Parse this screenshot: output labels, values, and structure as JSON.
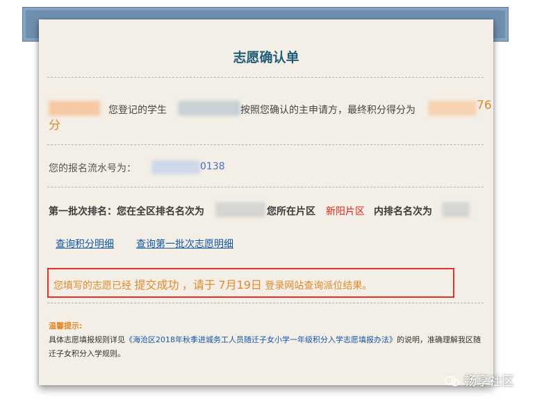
{
  "form": {
    "title": "志愿确认单",
    "line1": {
      "prefix": "您登记的学生",
      "middle": "按照您确认的主申请方，最终积分得分为",
      "score_tail": "76",
      "score_unit": "分"
    },
    "line2": {
      "label": "您的报名流水号为：",
      "serial_tail": "0138"
    },
    "line3": {
      "part1": "第一批次排名：您在全区排名名次为",
      "part2": "您所在片区",
      "district": "新阳片区",
      "part3": "内排名名次为"
    },
    "links": {
      "points_detail": "查询积分明细",
      "first_batch_detail": "查询第一批次志愿明细"
    },
    "notice": {
      "p1": "您填写的志愿已经",
      "p2": "提交成功",
      "p3": "，请于",
      "p4": "7月19日",
      "p5": "登录网站查询派位结果。"
    },
    "tips": {
      "title": "温馨提示:",
      "before": "具体志愿填报规则详见",
      "rule_link": "《海沧区2018年秋季进城务工人员随迁子女小学一年级积分入学志愿填报办法》",
      "after": "的说明，准确理解我区随迁子女积分入学规则。"
    }
  },
  "watermark": "畅享社区",
  "colors": {
    "title": "#1f5d78",
    "accent_orange": "#e0882b",
    "district_red": "#d6241c",
    "link_blue": "#1155aa",
    "notice_border": "#e2332b",
    "card_bg": "#f3efe6",
    "band_blue": "#6f8fae"
  }
}
